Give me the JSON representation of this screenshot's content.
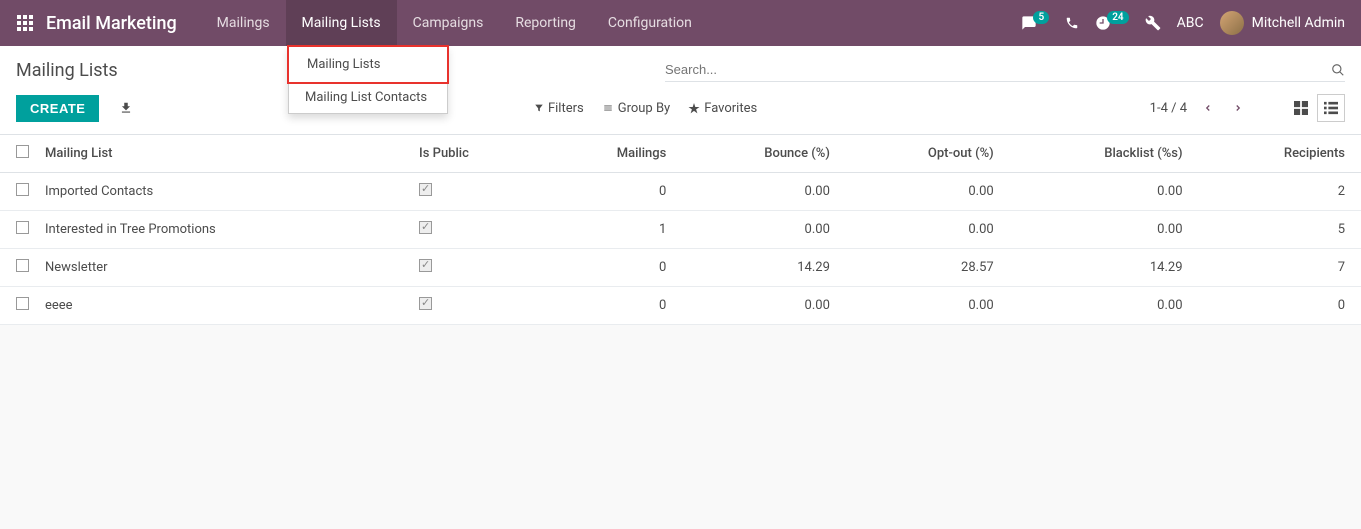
{
  "brand": "Email Marketing",
  "nav": {
    "items": [
      "Mailings",
      "Mailing Lists",
      "Campaigns",
      "Reporting",
      "Configuration"
    ],
    "active_index": 1
  },
  "nav_right": {
    "chat_count": "5",
    "activity_count": "24",
    "company": "ABC",
    "user": "Mitchell Admin"
  },
  "dropdown": {
    "items": [
      "Mailing Lists",
      "Mailing List Contacts"
    ],
    "highlighted_index": 0
  },
  "breadcrumb": "Mailing Lists",
  "buttons": {
    "create": "CREATE"
  },
  "search": {
    "placeholder": "Search...",
    "filters": "Filters",
    "groupby": "Group By",
    "favorites": "Favorites"
  },
  "pager": {
    "range": "1-4 / 4"
  },
  "table": {
    "columns": [
      "Mailing List",
      "Is Public",
      "Mailings",
      "Bounce (%)",
      "Opt-out (%)",
      "Blacklist (%s)",
      "Recipients"
    ],
    "rows": [
      {
        "name": "Imported Contacts",
        "is_public": true,
        "mailings": "0",
        "bounce": "0.00",
        "optout": "0.00",
        "blacklist": "0.00",
        "recipients": "2"
      },
      {
        "name": "Interested in Tree Promotions",
        "is_public": true,
        "mailings": "1",
        "bounce": "0.00",
        "optout": "0.00",
        "blacklist": "0.00",
        "recipients": "5"
      },
      {
        "name": "Newsletter",
        "is_public": true,
        "mailings": "0",
        "bounce": "14.29",
        "optout": "28.57",
        "blacklist": "14.29",
        "recipients": "7"
      },
      {
        "name": "eeee",
        "is_public": true,
        "mailings": "0",
        "bounce": "0.00",
        "optout": "0.00",
        "blacklist": "0.00",
        "recipients": "0"
      }
    ]
  }
}
